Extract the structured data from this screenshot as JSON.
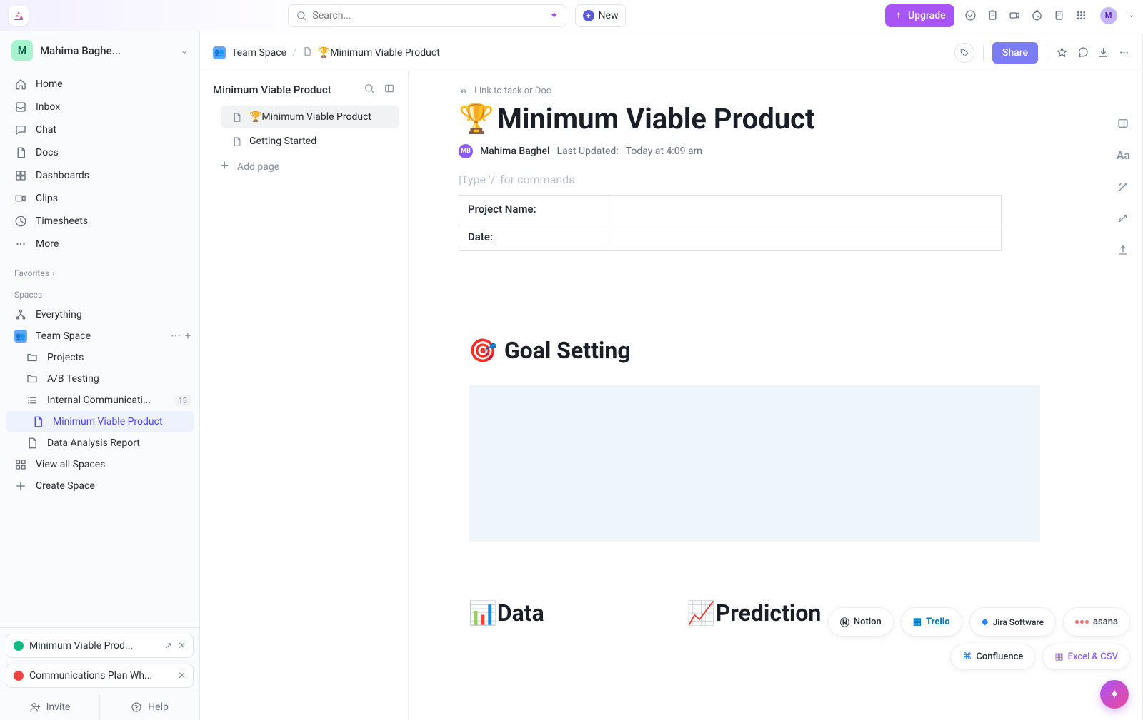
{
  "topbar": {
    "search_placeholder": "Search...",
    "new_label": "New",
    "upgrade_label": "Upgrade",
    "avatar_initial": "M"
  },
  "workspace": {
    "initial": "M",
    "name": "Mahima Baghe..."
  },
  "nav": {
    "home": "Home",
    "inbox": "Inbox",
    "chat": "Chat",
    "docs": "Docs",
    "dashboards": "Dashboards",
    "clips": "Clips",
    "timesheets": "Timesheets",
    "more": "More"
  },
  "sections": {
    "favorites": "Favorites",
    "spaces": "Spaces"
  },
  "spaces": {
    "everything": "Everything",
    "teamspace": "Team Space",
    "projects": "Projects",
    "ab": "A/B Testing",
    "internal": "Internal Communicati...",
    "internal_count": "13",
    "mvp": "Minimum Viable Product",
    "data": "Data Analysis Report",
    "viewall": "View all Spaces",
    "create": "Create Space"
  },
  "pills": {
    "mvp": "Minimum Viable Prod...",
    "comm": "Communications Plan Wh..."
  },
  "footer": {
    "invite": "Invite",
    "help": "Help"
  },
  "breadcrumb": {
    "teamspace": "Team Space",
    "doc": "🏆Minimum Viable Product"
  },
  "header": {
    "share": "Share"
  },
  "docnav": {
    "title": "Minimum Viable Product",
    "item1": "🏆Minimum Viable Product",
    "item2": "Getting Started",
    "add": "Add page"
  },
  "doc": {
    "linktask": "Link to task or Doc",
    "title_emoji": "🏆",
    "title": "Minimum Viable Product",
    "author_initials": "MB",
    "author": "Mahima Baghel",
    "updated_label": "Last Updated:",
    "updated_value": "Today at 4:09 am",
    "cmd_hint": "Type '/' for commands",
    "row1": "Project Name:",
    "row2": "Date:",
    "goal_heading": "Goal Setting",
    "data_heading": "Data",
    "pred_heading": "Prediction"
  },
  "chips": {
    "notion": "Notion",
    "trello": "Trello",
    "jira": "Jira Software",
    "asana": "asana",
    "confluence": "Confluence",
    "excel": "Excel & CSV"
  }
}
